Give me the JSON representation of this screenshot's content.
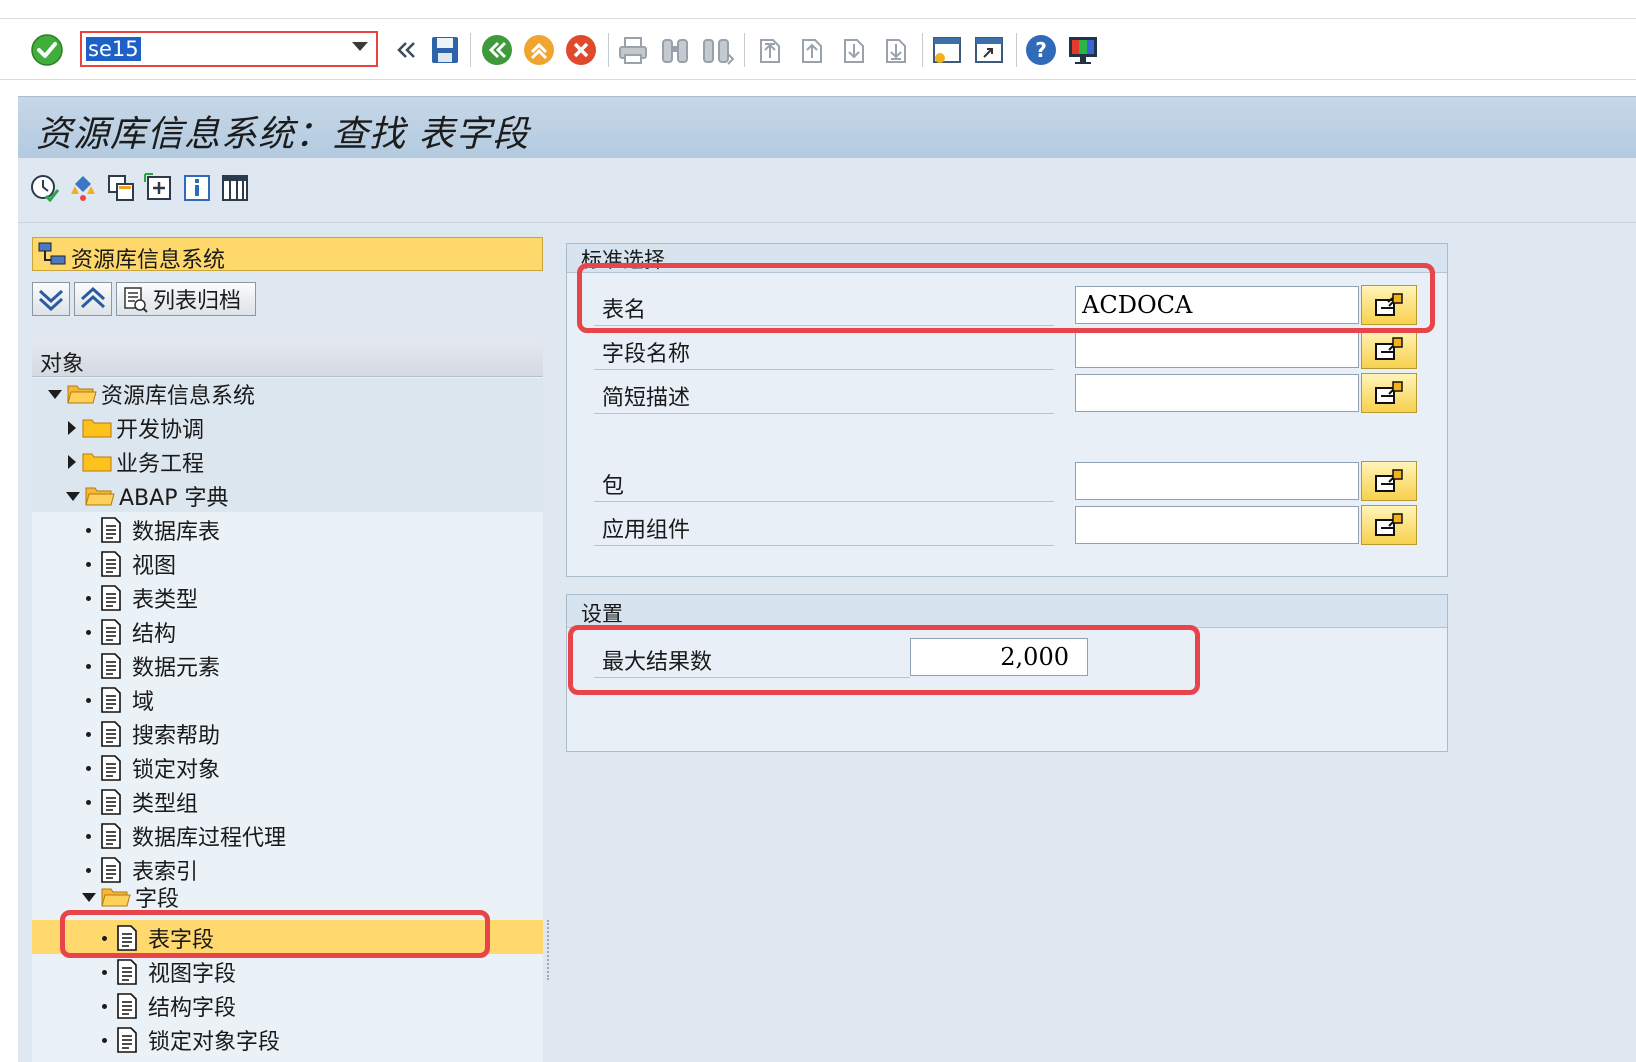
{
  "toolbar": {
    "command_value": "se15",
    "icons": [
      "enter-icon",
      "back-nav-icon",
      "save-icon",
      "back-icon",
      "exit-icon",
      "cancel-icon",
      "print-icon",
      "find-icon",
      "find-next-icon",
      "first-page-icon",
      "previous-page-icon",
      "next-page-icon",
      "last-page-icon",
      "new-session-icon",
      "shortcut-icon",
      "help-icon",
      "customize-layout-icon"
    ]
  },
  "title": "资源库信息系统：查找 表字段",
  "navigation": {
    "header": "资源库信息系统",
    "archive_button": "列表归档",
    "tree_header": "对象",
    "tree": [
      {
        "label": "资源库信息系统",
        "level": 0,
        "type": "folder-open"
      },
      {
        "label": "开发协调",
        "level": 1,
        "type": "folder"
      },
      {
        "label": "业务工程",
        "level": 1,
        "type": "folder"
      },
      {
        "label": "ABAP 字典",
        "level": 1,
        "type": "folder-open"
      },
      {
        "label": "数据库表",
        "level": 2,
        "type": "doc"
      },
      {
        "label": "视图",
        "level": 2,
        "type": "doc"
      },
      {
        "label": "表类型",
        "level": 2,
        "type": "doc"
      },
      {
        "label": "结构",
        "level": 2,
        "type": "doc"
      },
      {
        "label": "数据元素",
        "level": 2,
        "type": "doc"
      },
      {
        "label": "域",
        "level": 2,
        "type": "doc"
      },
      {
        "label": "搜索帮助",
        "level": 2,
        "type": "doc"
      },
      {
        "label": "锁定对象",
        "level": 2,
        "type": "doc"
      },
      {
        "label": "类型组",
        "level": 2,
        "type": "doc"
      },
      {
        "label": "数据库过程代理",
        "level": 2,
        "type": "doc"
      },
      {
        "label": "表索引",
        "level": 2,
        "type": "doc"
      },
      {
        "label": "字段",
        "level": 2,
        "type": "folder-open"
      },
      {
        "label": "表字段",
        "level": 3,
        "type": "doc",
        "selected": true
      },
      {
        "label": "视图字段",
        "level": 3,
        "type": "doc"
      },
      {
        "label": "结构字段",
        "level": 3,
        "type": "doc"
      },
      {
        "label": "锁定对象字段",
        "level": 3,
        "type": "doc"
      }
    ]
  },
  "selection": {
    "group_title": "标准选择",
    "fields": [
      {
        "label": "表名",
        "value": "ACDOCA"
      },
      {
        "label": "字段名称",
        "value": ""
      },
      {
        "label": "简短描述",
        "value": ""
      },
      {
        "label": "包",
        "value": ""
      },
      {
        "label": "应用组件",
        "value": ""
      }
    ]
  },
  "settings": {
    "group_title": "设置",
    "max_results_label": "最大结果数",
    "max_results_value": "2,000"
  },
  "colors": {
    "highlight_red": "#e8454a",
    "nav_yellow": "#ffd86b",
    "title_blue": "#b3cadf",
    "panel_bg": "#dfe8f1"
  }
}
